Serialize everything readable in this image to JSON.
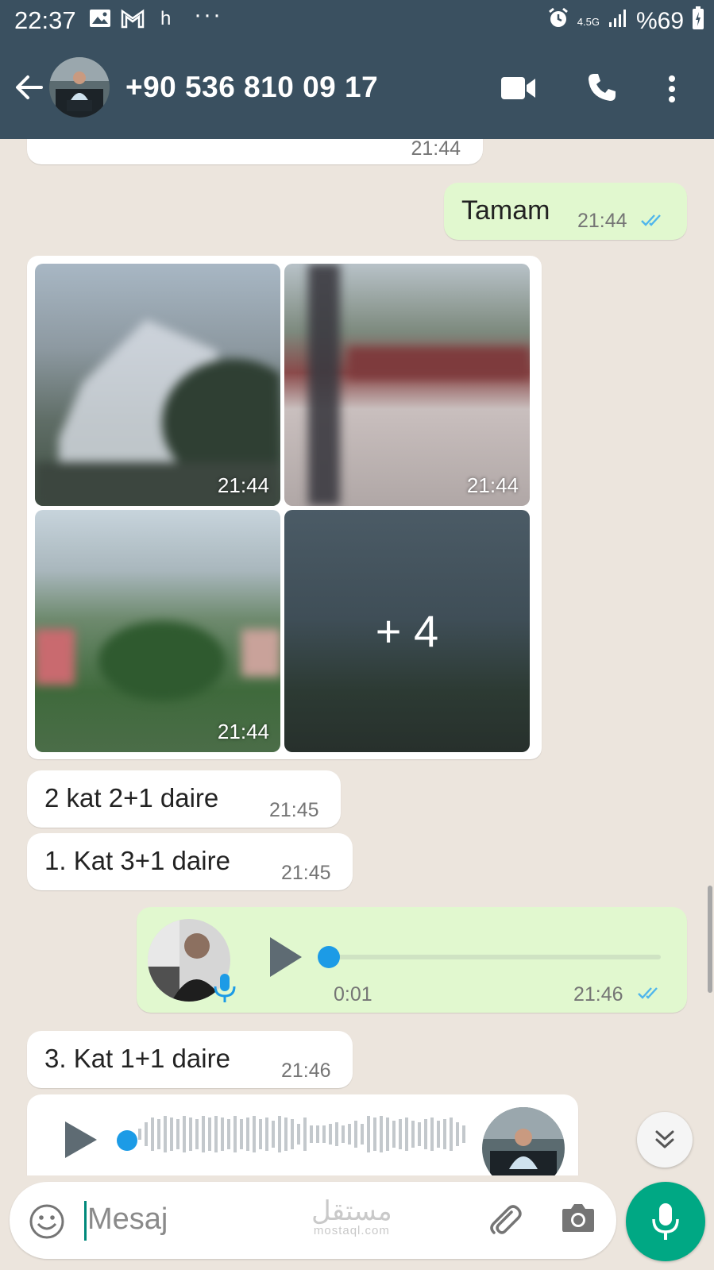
{
  "status_bar": {
    "time": "22:37",
    "notif_letter": "h",
    "dots": "···",
    "network": "4.5G",
    "battery": "%69",
    "icons": [
      "image-icon",
      "gmail-icon",
      "alarm-icon",
      "signal-icon",
      "battery-icon"
    ]
  },
  "header": {
    "contact": "+90 536 810 09 17",
    "icons": [
      "back-arrow-icon",
      "video-call-icon",
      "phone-icon",
      "more-vert-icon"
    ]
  },
  "messages": {
    "partial_top": {
      "time": "21:44"
    },
    "tamam": {
      "text": "Tamam",
      "time": "21:44",
      "status": "read"
    },
    "photos": {
      "times": [
        "21:44",
        "21:44",
        "21:44"
      ],
      "more_label": "+ 4"
    },
    "msg1": {
      "text": "2 kat 2+1 daire",
      "time": "21:45"
    },
    "msg2": {
      "text": "1. Kat 3+1 daire",
      "time": "21:45"
    },
    "voice_out": {
      "duration": "0:01",
      "time": "21:46",
      "status": "read",
      "progress": 0
    },
    "msg3": {
      "text": "3. Kat 1+1 daire",
      "time": "21:46"
    }
  },
  "composer": {
    "placeholder": "Mesaj",
    "watermark": "مستقل",
    "watermark_sub": "mostaql.com"
  },
  "colors": {
    "header_bg": "#3a5060",
    "outgoing_bubble": "#e1f8cf",
    "incoming_bubble": "#ffffff",
    "chat_bg": "#ece5dd",
    "accent": "#00a884",
    "read_tick": "#4fb6ec",
    "voice_dot": "#1c9be6"
  }
}
